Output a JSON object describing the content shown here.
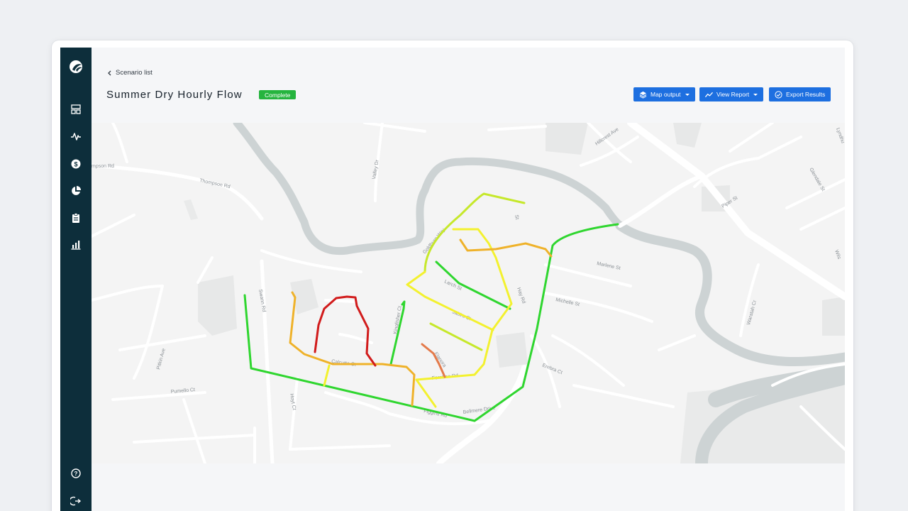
{
  "breadcrumb": {
    "back_label": "Scenario list"
  },
  "header": {
    "title": "Summer Dry Hourly Flow",
    "status": "Complete"
  },
  "toolbar": {
    "map_output_label": "Map output",
    "view_report_label": "View Report",
    "export_results_label": "Export Results"
  },
  "sidebar": {
    "items": [
      {
        "icon": "dashboard-icon"
      },
      {
        "icon": "activity-icon"
      },
      {
        "icon": "dollar-icon"
      },
      {
        "icon": "pie-chart-icon"
      },
      {
        "icon": "clipboard-icon"
      },
      {
        "icon": "bar-chart-icon"
      }
    ],
    "bottom": [
      {
        "icon": "help-icon"
      },
      {
        "icon": "logout-icon"
      }
    ]
  },
  "map": {
    "streets": {
      "thompson_rd_partial": "mpson Rd",
      "thompson_rd": "Thompson Rd",
      "valley_dr": "Valley Dr",
      "hillcrest_ave": "Hillcrest Ave",
      "lyndhurst": "Lyndhu",
      "glendale_st": "Glendale St",
      "piper_st": "Piper St",
      "st_top": "St",
      "goldburn_way": "Goldburn Way",
      "marlene_st": "Marlene St",
      "michelle_st": "Michelle St",
      "waratah_cr": "Waratah Cr",
      "wils": "Wils",
      "swann_rd": "Swann Rd",
      "pitkin_ave": "Pitkin Ave",
      "pumello_ct": "Pumello Ct",
      "hoyt_ct": "Hoyt Ct",
      "calcutta_ct": "Calcutta Ct",
      "erebra_ct": "Erebra Ct",
      "bellmere_drive": "Bellmere Drive",
      "figgins_rd": "Figgins Rd",
      "ferntree_rd": "Ferntree Rd",
      "jabiru_st": "Jabiru St",
      "larch_st": "Larch St",
      "kingfisher": "Kingfisher Ct",
      "hay_rd": "Hay Rd",
      "elanora": "Elanora"
    },
    "flow_colors": {
      "low": "#2fd62f",
      "medium_low": "#c6e82b",
      "medium": "#f3f12f",
      "medium_high": "#efb22a",
      "high": "#e47a4a",
      "critical": "#d11b1b"
    }
  }
}
